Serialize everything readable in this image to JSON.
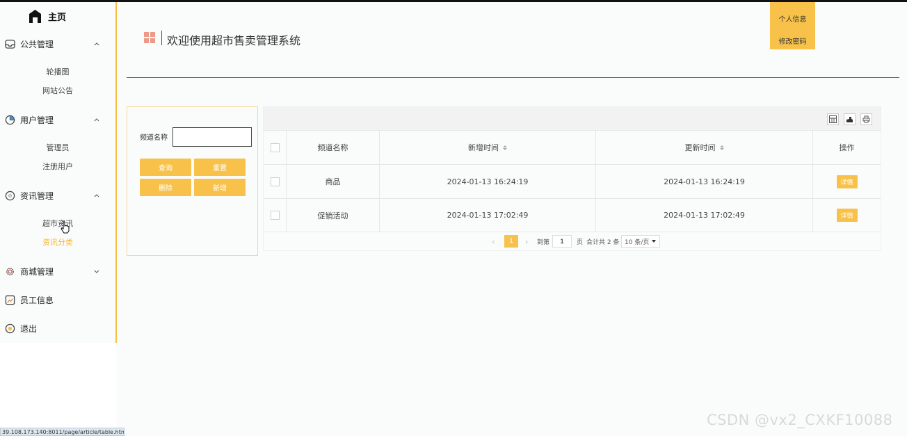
{
  "sidebar": {
    "home_label": "主页",
    "groups": [
      {
        "label": "公共管理",
        "icon": "inbox-icon",
        "expanded": true,
        "items": [
          "轮播图",
          "网站公告"
        ]
      },
      {
        "label": "用户管理",
        "icon": "pie-chart-icon",
        "expanded": true,
        "items": [
          "管理员",
          "注册用户"
        ]
      },
      {
        "label": "资讯管理",
        "icon": "circle-info-icon",
        "expanded": true,
        "items": [
          "超市资讯",
          "资讯分类"
        ],
        "active_item": "资讯分类"
      },
      {
        "label": "商城管理",
        "icon": "gear-icon",
        "expanded": false
      },
      {
        "label": "员工信息",
        "icon": "id-card-icon"
      },
      {
        "label": "退出",
        "icon": "logout-icon"
      }
    ]
  },
  "header": {
    "title": "欢迎使用超市售卖管理系统",
    "profile_label": "个人信息",
    "password_label": "修改密码"
  },
  "search": {
    "field_label": "频道名称",
    "field_value": "",
    "query_label": "查询",
    "reset_label": "重置",
    "delete_label": "删除",
    "add_label": "新增"
  },
  "table": {
    "columns": [
      "频道名称",
      "新增时间",
      "更新时间",
      "操作"
    ],
    "rows": [
      {
        "name": "商品",
        "created": "2024-01-13 16:24:19",
        "updated": "2024-01-13 16:24:19",
        "action": "详情"
      },
      {
        "name": "促销活动",
        "created": "2024-01-13 17:02:49",
        "updated": "2024-01-13 17:02:49",
        "action": "详情"
      }
    ]
  },
  "pager": {
    "current_page": "1",
    "goto_label": "到第",
    "goto_value": "1",
    "page_unit": "页",
    "total_text": "合计共 2 条",
    "page_size": "10 条/页"
  },
  "statusbar_url": "39.108.173.140:8011/page/article/table.html",
  "watermark": "CSDN @vx2_CXKF10088",
  "colors": {
    "accent": "#f8c24a",
    "active_text": "#f7b42c",
    "sidebar_border": "#f7c042"
  }
}
